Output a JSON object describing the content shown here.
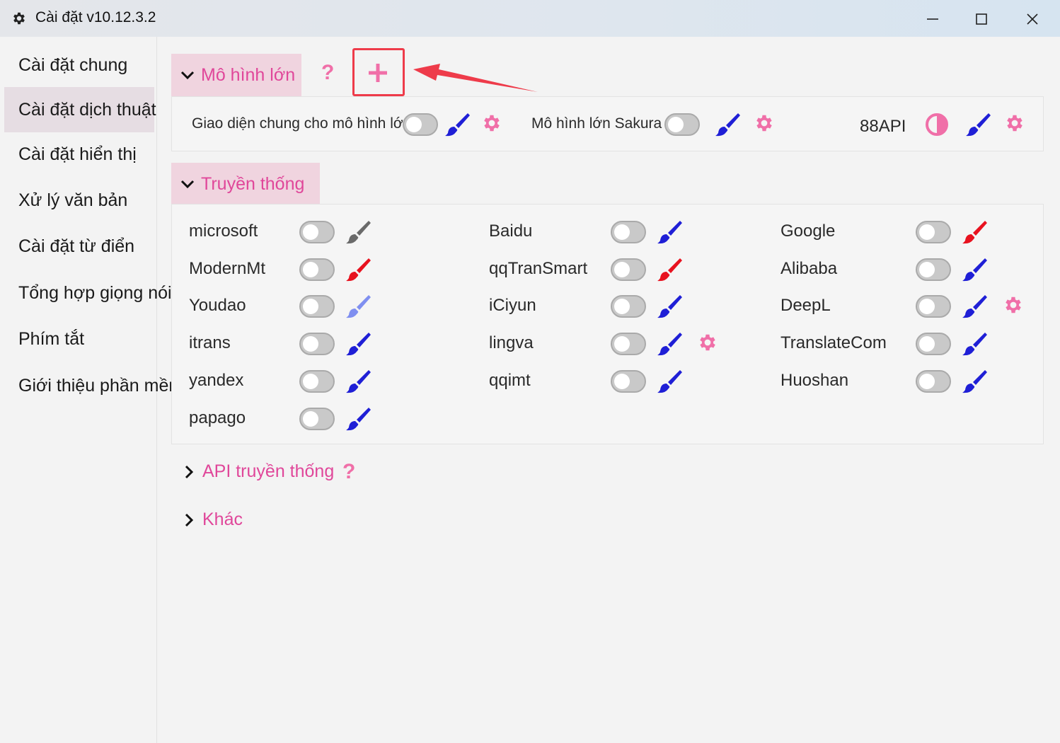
{
  "window": {
    "title": "Cài đặt v10.12.3.2",
    "icon": "gear-icon"
  },
  "sidebar": {
    "items": [
      {
        "label": "Cài đặt chung",
        "active": false
      },
      {
        "label": "Cài đặt dịch thuật",
        "active": true
      },
      {
        "label": "Cài đặt hiển thị",
        "active": false
      },
      {
        "label": "Xử lý văn bản",
        "active": false
      },
      {
        "label": "Cài đặt từ điển",
        "active": false
      },
      {
        "label": "Tổng hợp giọng nói",
        "active": false
      },
      {
        "label": "Phím tắt",
        "active": false
      },
      {
        "label": "Giới thiệu phần mềm",
        "active": false
      }
    ]
  },
  "large_model": {
    "title": "Mô hình lớn",
    "help": "?",
    "add": "+",
    "items": [
      {
        "label": "Giao diện chung cho mô hình lớn",
        "enabled": false,
        "brush_color": "#1f1fd6",
        "settings": true
      },
      {
        "label": "Mô hình lớn Sakura",
        "enabled": false,
        "brush_color": "#1f1fd6",
        "settings": true
      },
      {
        "label": "88API",
        "state": "half",
        "brush_color": "#1f1fd6",
        "settings": true
      }
    ]
  },
  "traditional": {
    "title": "Truyền thống",
    "columns": [
      [
        {
          "label": "microsoft",
          "enabled": false,
          "brush_color": "#6a6a6a"
        },
        {
          "label": "ModernMt",
          "enabled": false,
          "brush_color": "#e8121f"
        },
        {
          "label": "Youdao",
          "enabled": false,
          "brush_color": "#7f8ff0"
        },
        {
          "label": "itrans",
          "enabled": false,
          "brush_color": "#1f1fd6"
        },
        {
          "label": "yandex",
          "enabled": false,
          "brush_color": "#1f1fd6"
        },
        {
          "label": "papago",
          "enabled": false,
          "brush_color": "#1f1fd6"
        }
      ],
      [
        {
          "label": "Baidu",
          "enabled": false,
          "brush_color": "#1f1fd6"
        },
        {
          "label": "qqTranSmart",
          "enabled": false,
          "brush_color": "#e8121f"
        },
        {
          "label": "iCiyun",
          "enabled": false,
          "brush_color": "#1f1fd6"
        },
        {
          "label": "lingva",
          "enabled": false,
          "brush_color": "#1f1fd6",
          "settings": true
        },
        {
          "label": "qqimt",
          "enabled": false,
          "brush_color": "#1f1fd6"
        }
      ],
      [
        {
          "label": "Google",
          "enabled": false,
          "brush_color": "#e8121f"
        },
        {
          "label": "Alibaba",
          "enabled": false,
          "brush_color": "#1f1fd6"
        },
        {
          "label": "DeepL",
          "enabled": false,
          "brush_color": "#1f1fd6",
          "settings": true
        },
        {
          "label": "TranslateCom",
          "enabled": false,
          "brush_color": "#1f1fd6"
        },
        {
          "label": "Huoshan",
          "enabled": false,
          "brush_color": "#1f1fd6"
        }
      ]
    ]
  },
  "collapsed_sections": [
    {
      "label": "API truyền thống",
      "help": "?"
    },
    {
      "label": "Khác"
    }
  ],
  "colors": {
    "accent": "#e0479a",
    "header_bg": "#f0d4df",
    "highlight": "#ee3b4a"
  }
}
